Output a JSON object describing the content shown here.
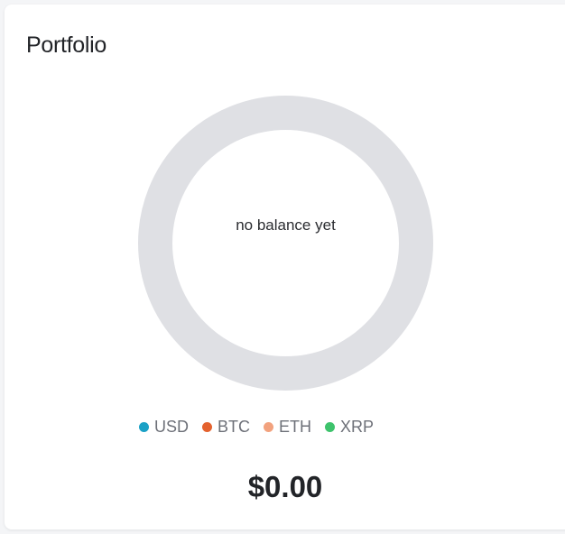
{
  "card": {
    "title": "Portfolio",
    "empty_message": "no balance yet",
    "total": "$0.00"
  },
  "legend": [
    {
      "label": "USD",
      "color": "#1ba1c6"
    },
    {
      "label": "BTC",
      "color": "#e4622e"
    },
    {
      "label": "ETH",
      "color": "#f2a27e"
    },
    {
      "label": "XRP",
      "color": "#3ec36c"
    }
  ],
  "donut": {
    "ring_color": "#dfe0e4"
  }
}
